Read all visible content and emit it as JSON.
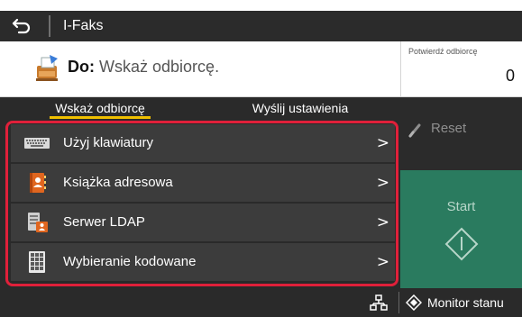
{
  "title_bar": {
    "title": "I-Faks",
    "back_icon": "back-arrow-icon"
  },
  "destination": {
    "prefix": "Do:",
    "value": "Wskaż odbiorcę.",
    "icon": "fax-machine-icon"
  },
  "confirm": {
    "label": "Potwierdź odbiorcę",
    "count": "0"
  },
  "tabs": [
    {
      "label": "Wskaż odbiorcę",
      "active": true
    },
    {
      "label": "Wyślij ustawienia",
      "active": false
    }
  ],
  "list": [
    {
      "label": "Użyj klawiatury",
      "icon": "keyboard-icon"
    },
    {
      "label": "Książka adresowa",
      "icon": "address-book-icon"
    },
    {
      "label": "Serwer LDAP",
      "icon": "ldap-server-icon"
    },
    {
      "label": "Wybieranie kodowane",
      "icon": "coded-dial-icon"
    }
  ],
  "chevron": ">",
  "actions": {
    "reset_label": "Reset",
    "start_label": "Start"
  },
  "footer": {
    "status_label": "Monitor stanu",
    "network_icon": "network-icon"
  },
  "colors": {
    "highlight": "#e0203a",
    "tab_underline": "#f0c000",
    "start_bg": "#2a7b5f",
    "dark_bg": "#2a2a2a"
  }
}
